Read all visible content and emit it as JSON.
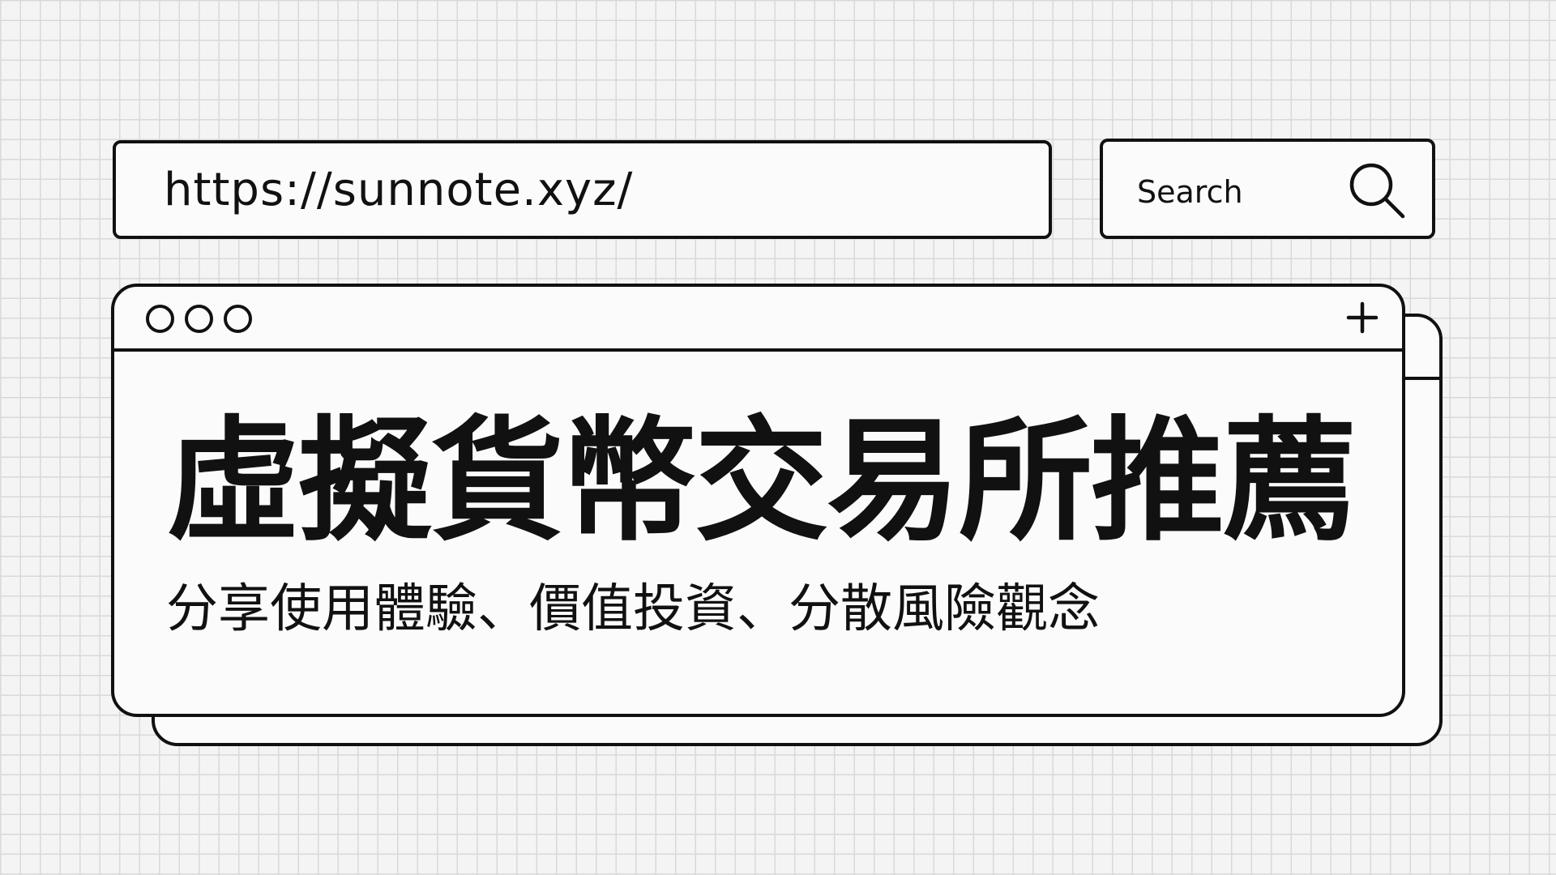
{
  "address_bar": {
    "url": "https://sunnote.xyz/"
  },
  "search": {
    "label": "Search",
    "icon": "search-icon"
  },
  "window": {
    "controls": [
      "circle",
      "circle",
      "circle"
    ],
    "new_tab_icon": "plus-icon",
    "headline": "虛擬貨幣交易所推薦",
    "subtitle": "分享使用體驗、價值投資、分散風險觀念"
  },
  "colors": {
    "background": "#f4f4f4",
    "grid_line": "#d9d9d9",
    "stroke": "#111111",
    "panel": "#fbfbfb"
  }
}
